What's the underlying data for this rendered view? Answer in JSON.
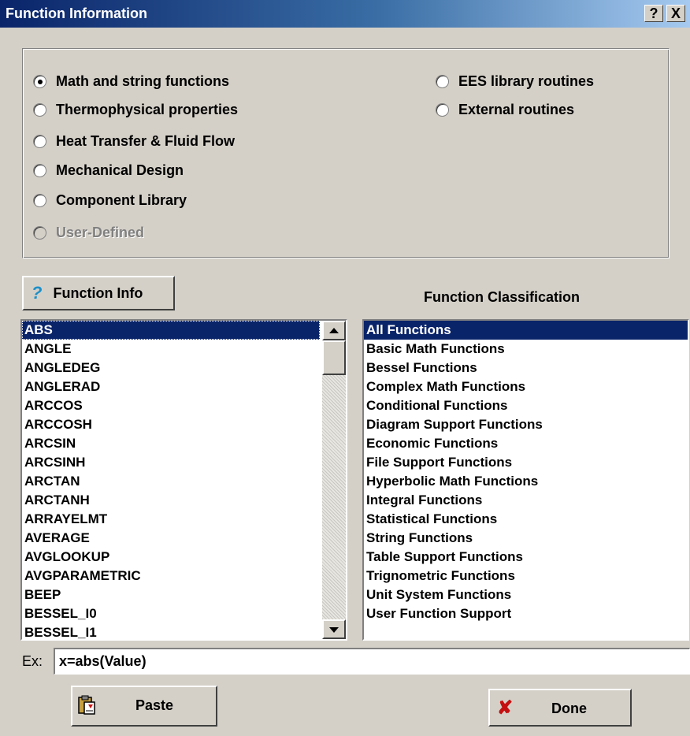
{
  "window": {
    "title": "Function Information",
    "help_label": "?",
    "close_label": "X"
  },
  "categories": [
    {
      "label": "Math and string functions",
      "selected": true,
      "enabled": true
    },
    {
      "label": "Thermophysical properties",
      "selected": false,
      "enabled": true
    },
    {
      "label": "Heat Transfer & Fluid Flow",
      "selected": false,
      "enabled": true
    },
    {
      "label": "Mechanical Design",
      "selected": false,
      "enabled": true
    },
    {
      "label": "Component Library",
      "selected": false,
      "enabled": true
    },
    {
      "label": "User-Defined",
      "selected": false,
      "enabled": false
    },
    {
      "label": "EES library routines",
      "selected": false,
      "enabled": true
    },
    {
      "label": "External routines",
      "selected": false,
      "enabled": true
    }
  ],
  "function_info_button": {
    "label": "Function Info",
    "icon": "question-icon"
  },
  "classification_label": "Function Classification",
  "functions": [
    "ABS",
    "ANGLE",
    "ANGLEDEG",
    "ANGLERAD",
    "ARCCOS",
    "ARCCOSH",
    "ARCSIN",
    "ARCSINH",
    "ARCTAN",
    "ARCTANH",
    "ARRAYELMT",
    "AVERAGE",
    "AVGLOOKUP",
    "AVGPARAMETRIC",
    "BEEP",
    "BESSEL_I0",
    "BESSEL_I1"
  ],
  "selected_function": "ABS",
  "classifications": [
    "All Functions",
    "Basic Math Functions",
    "Bessel Functions",
    "Complex Math Functions",
    "Conditional Functions",
    "Diagram Support Functions",
    "Economic Functions",
    "File Support Functions",
    "Hyperbolic Math Functions",
    "Integral Functions",
    "Statistical Functions",
    "String Functions",
    "Table Support Functions",
    "Trignometric Functions",
    "Unit System Functions",
    "User Function Support"
  ],
  "selected_classification": "All Functions",
  "example": {
    "label": "Ex:",
    "value": "x=abs(Value)"
  },
  "paste_button": {
    "label": "Paste",
    "icon": "clipboard-paste-icon"
  },
  "done_button": {
    "label": "Done",
    "icon": "red-x-icon",
    "icon_glyph": "✘"
  },
  "colors": {
    "titlebar": "#0a246a",
    "selection": "#0a246a",
    "dialog": "#d4d0c8",
    "info_icon": "#1a8fc9",
    "done_icon": "#c41010"
  }
}
